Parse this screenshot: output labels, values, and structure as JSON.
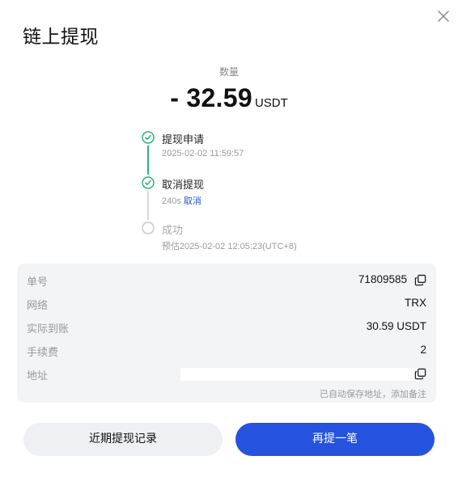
{
  "dialog": {
    "title": "链上提现"
  },
  "amount": {
    "label": "数量",
    "value": "- 32.59",
    "unit": "USDT"
  },
  "timeline": {
    "steps": [
      {
        "title": "提现申请",
        "sub": "2025-02-02 11:59:57",
        "status": "done"
      },
      {
        "title": "取消提现",
        "sub": "240s",
        "link": "取消",
        "status": "done"
      },
      {
        "title": "成功",
        "sub": "预估2025-02-02 12:05:23(UTC+8)",
        "status": "pending"
      }
    ]
  },
  "details": {
    "order_label": "单号",
    "order_value": "71809585",
    "network_label": "网络",
    "network_value": "TRX",
    "received_label": "实际到账",
    "received_value": "30.59 USDT",
    "fee_label": "手续费",
    "fee_value": "2",
    "address_label": "地址",
    "note": "已自动保存地址，添加备注"
  },
  "buttons": {
    "history": "近期提现记录",
    "again": "再提一笔"
  },
  "colors": {
    "accent": "#2553e0",
    "success": "#2db37d",
    "link": "#2756d8"
  },
  "icons": {
    "close": "close-icon",
    "copy": "copy-icon",
    "check": "check-circle-icon",
    "pending": "empty-circle-icon"
  }
}
